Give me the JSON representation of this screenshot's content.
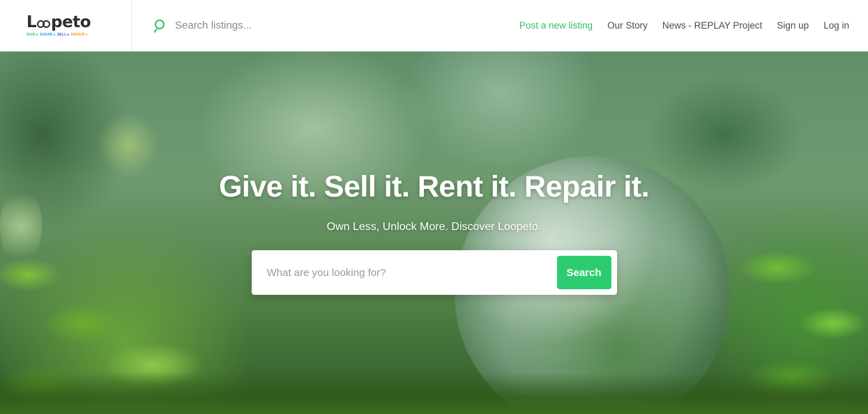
{
  "brand": {
    "logo_text": "Loopeto",
    "tagline": [
      {
        "text": "GIVE ▸",
        "color": "#2fbf63"
      },
      {
        "text": "SHARE ▸",
        "color": "#2aa3d8"
      },
      {
        "text": "SELL ▸",
        "color": "#3b5bd6"
      },
      {
        "text": "REPAIR ▸",
        "color": "#e8a02a"
      }
    ]
  },
  "top_search": {
    "placeholder": "Search listings...",
    "icon": "search-icon"
  },
  "nav": {
    "post_listing": "Post a new listing",
    "our_story": "Our Story",
    "news": "News - REPLAY Project",
    "sign_up": "Sign up",
    "log_in": "Log in"
  },
  "hero": {
    "title": "Give it. Sell it. Rent it. Repair it.",
    "subtitle": "Own Less, Unlock More. Discover Loopeto.",
    "search_placeholder": "What are you looking for?",
    "search_button": "Search"
  },
  "colors": {
    "accent": "#2fbf63",
    "button": "#2ecc71",
    "text": "#4a4a4a"
  }
}
